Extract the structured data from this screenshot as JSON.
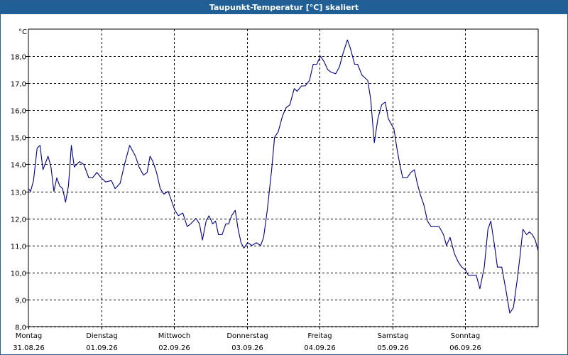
{
  "window": {
    "title": "Taupunkt-Temperatur [°C] skaliert"
  },
  "colors": {
    "titlebar": "#1f5f96",
    "line": "#00008b",
    "grid": "#000000",
    "background": "#ffffff"
  },
  "chart_data": {
    "type": "line",
    "title": "Taupunkt-Temperatur [°C] skaliert",
    "ylabel": "°C",
    "ylim": [
      8.0,
      19.0
    ],
    "yticks": [
      "8,0",
      "9,0",
      "10,0",
      "11,0",
      "12,0",
      "13,0",
      "14,0",
      "15,0",
      "16,0",
      "17,0",
      "18,0"
    ],
    "ytick_values": [
      8,
      9,
      10,
      11,
      12,
      13,
      14,
      15,
      16,
      17,
      18
    ],
    "xlim": [
      0,
      7
    ],
    "x_categories": [
      {
        "day": "Montag",
        "date": "31.08.26"
      },
      {
        "day": "Dienstag",
        "date": "01.09.26"
      },
      {
        "day": "Mittwoch",
        "date": "02.09.26"
      },
      {
        "day": "Donnerstag",
        "date": "03.09.26"
      },
      {
        "day": "Freitag",
        "date": "04.09.26"
      },
      {
        "day": "Samstag",
        "date": "05.09.26"
      },
      {
        "day": "Sonntag",
        "date": "06.09.26"
      }
    ],
    "grid": true,
    "series": [
      {
        "values": [
          [
            0.0,
            13.1
          ],
          [
            0.03,
            13.0
          ],
          [
            0.07,
            13.4
          ],
          [
            0.12,
            14.6
          ],
          [
            0.16,
            14.7
          ],
          [
            0.2,
            13.8
          ],
          [
            0.27,
            14.3
          ],
          [
            0.31,
            13.9
          ],
          [
            0.35,
            13.0
          ],
          [
            0.39,
            13.5
          ],
          [
            0.43,
            13.2
          ],
          [
            0.47,
            13.1
          ],
          [
            0.51,
            12.6
          ],
          [
            0.55,
            13.2
          ],
          [
            0.59,
            14.7
          ],
          [
            0.63,
            13.9
          ],
          [
            0.7,
            14.1
          ],
          [
            0.76,
            14.0
          ],
          [
            0.83,
            13.5
          ],
          [
            0.88,
            13.5
          ],
          [
            0.94,
            13.7
          ],
          [
            1.0,
            13.5
          ],
          [
            1.06,
            13.35
          ],
          [
            1.14,
            13.4
          ],
          [
            1.19,
            13.1
          ],
          [
            1.26,
            13.3
          ],
          [
            1.32,
            14.0
          ],
          [
            1.39,
            14.7
          ],
          [
            1.43,
            14.5
          ],
          [
            1.47,
            14.3
          ],
          [
            1.52,
            13.9
          ],
          [
            1.58,
            13.6
          ],
          [
            1.63,
            13.7
          ],
          [
            1.67,
            14.3
          ],
          [
            1.71,
            14.1
          ],
          [
            1.76,
            13.7
          ],
          [
            1.81,
            13.1
          ],
          [
            1.86,
            12.9
          ],
          [
            1.92,
            13.0
          ],
          [
            1.96,
            12.7
          ],
          [
            2.01,
            12.3
          ],
          [
            2.06,
            12.1
          ],
          [
            2.12,
            12.2
          ],
          [
            2.18,
            11.7
          ],
          [
            2.23,
            11.8
          ],
          [
            2.3,
            12.0
          ],
          [
            2.35,
            11.8
          ],
          [
            2.39,
            11.2
          ],
          [
            2.44,
            11.9
          ],
          [
            2.48,
            12.1
          ],
          [
            2.53,
            11.8
          ],
          [
            2.57,
            11.9
          ],
          [
            2.61,
            11.4
          ],
          [
            2.66,
            11.4
          ],
          [
            2.71,
            11.8
          ],
          [
            2.75,
            11.8
          ],
          [
            2.79,
            12.1
          ],
          [
            2.84,
            12.3
          ],
          [
            2.88,
            11.6
          ],
          [
            2.92,
            11.1
          ],
          [
            2.96,
            10.9
          ],
          [
            3.01,
            11.1
          ],
          [
            3.07,
            11.0
          ],
          [
            3.13,
            11.1
          ],
          [
            3.19,
            11.0
          ],
          [
            3.23,
            11.3
          ],
          [
            3.28,
            12.3
          ],
          [
            3.34,
            13.8
          ],
          [
            3.38,
            15.0
          ],
          [
            3.43,
            15.2
          ],
          [
            3.49,
            15.8
          ],
          [
            3.54,
            16.1
          ],
          [
            3.59,
            16.2
          ],
          [
            3.65,
            16.8
          ],
          [
            3.69,
            16.7
          ],
          [
            3.75,
            16.9
          ],
          [
            3.8,
            16.9
          ],
          [
            3.86,
            17.1
          ],
          [
            3.91,
            17.7
          ],
          [
            3.96,
            17.7
          ],
          [
            4.01,
            18.0
          ],
          [
            4.06,
            17.8
          ],
          [
            4.11,
            17.5
          ],
          [
            4.16,
            17.4
          ],
          [
            4.22,
            17.35
          ],
          [
            4.27,
            17.6
          ],
          [
            4.32,
            18.1
          ],
          [
            4.38,
            18.6
          ],
          [
            4.42,
            18.3
          ],
          [
            4.48,
            17.7
          ],
          [
            4.52,
            17.7
          ],
          [
            4.58,
            17.3
          ],
          [
            4.62,
            17.2
          ],
          [
            4.66,
            17.1
          ],
          [
            4.7,
            16.4
          ],
          [
            4.75,
            14.8
          ],
          [
            4.8,
            15.7
          ],
          [
            4.85,
            16.2
          ],
          [
            4.9,
            16.3
          ],
          [
            4.94,
            15.7
          ],
          [
            4.98,
            15.5
          ],
          [
            5.02,
            15.3
          ],
          [
            5.06,
            14.6
          ],
          [
            5.1,
            14.0
          ],
          [
            5.14,
            13.5
          ],
          [
            5.2,
            13.5
          ],
          [
            5.25,
            13.7
          ],
          [
            5.3,
            13.8
          ],
          [
            5.34,
            13.3
          ],
          [
            5.38,
            12.9
          ],
          [
            5.43,
            12.5
          ],
          [
            5.48,
            11.9
          ],
          [
            5.53,
            11.7
          ],
          [
            5.58,
            11.7
          ],
          [
            5.64,
            11.7
          ],
          [
            5.7,
            11.4
          ],
          [
            5.74,
            11.0
          ],
          [
            5.79,
            11.3
          ],
          [
            5.85,
            10.7
          ],
          [
            5.9,
            10.4
          ],
          [
            5.95,
            10.2
          ],
          [
            6.0,
            10.1
          ],
          [
            6.04,
            9.9
          ],
          [
            6.09,
            9.9
          ],
          [
            6.15,
            9.9
          ],
          [
            6.2,
            9.4
          ],
          [
            6.26,
            10.2
          ],
          [
            6.31,
            11.6
          ],
          [
            6.35,
            11.9
          ],
          [
            6.4,
            11.0
          ],
          [
            6.44,
            10.2
          ],
          [
            6.5,
            10.2
          ],
          [
            6.56,
            9.3
          ],
          [
            6.61,
            8.5
          ],
          [
            6.66,
            8.7
          ],
          [
            6.71,
            9.7
          ],
          [
            6.75,
            10.6
          ],
          [
            6.79,
            11.6
          ],
          [
            6.84,
            11.4
          ],
          [
            6.88,
            11.5
          ],
          [
            6.92,
            11.4
          ],
          [
            6.96,
            11.2
          ],
          [
            7.0,
            10.8
          ]
        ]
      }
    ]
  }
}
